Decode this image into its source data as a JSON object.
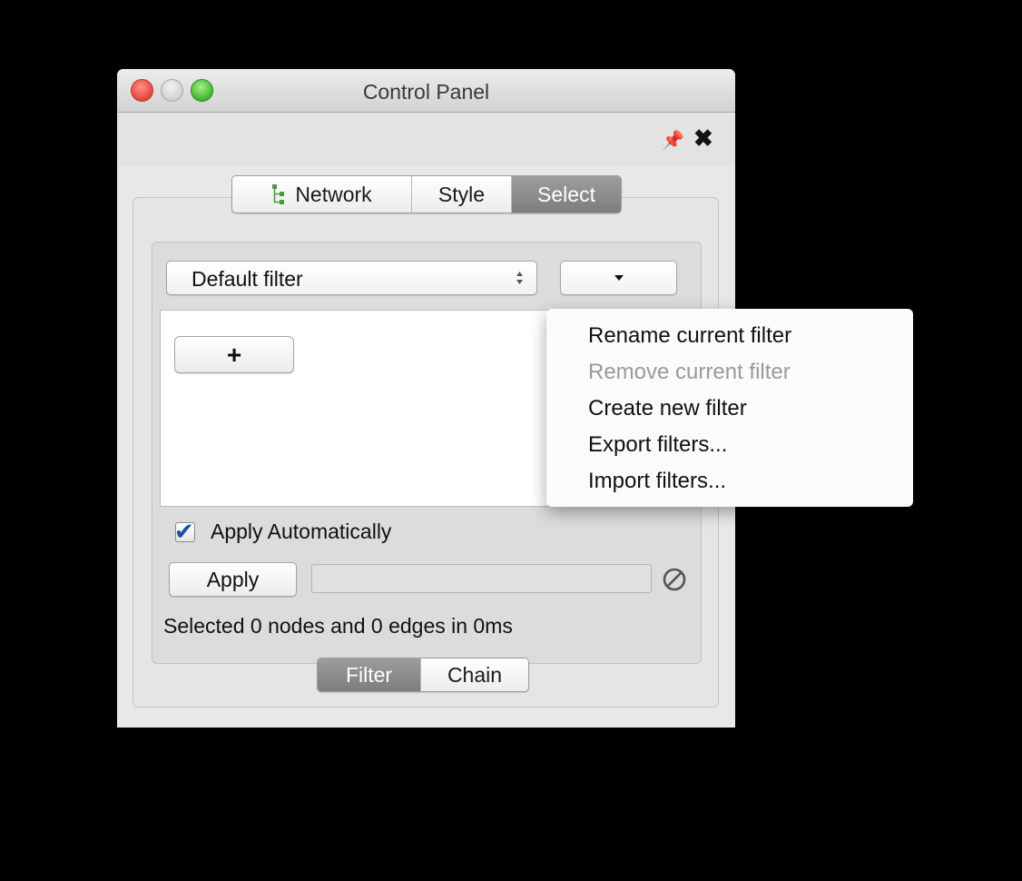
{
  "window": {
    "title": "Control Panel"
  },
  "header": {
    "pin_icon": "pin-icon",
    "close_icon": "close-icon"
  },
  "main_tabs": [
    {
      "label": "Network",
      "icon": "network-tree-icon",
      "active": false
    },
    {
      "label": "Style",
      "active": false
    },
    {
      "label": "Select",
      "active": true
    }
  ],
  "filter": {
    "selected": "Default filter",
    "menu_button_icon": "caret-down-icon",
    "add_label": "+"
  },
  "dropdown": {
    "items": [
      {
        "label": "Rename current filter",
        "enabled": true
      },
      {
        "label": "Remove current filter",
        "enabled": false
      },
      {
        "label": "Create new filter",
        "enabled": true
      },
      {
        "label": "Export filters...",
        "enabled": true
      },
      {
        "label": "Import filters...",
        "enabled": true
      }
    ]
  },
  "apply_automatically": {
    "label": "Apply Automatically",
    "checked": true
  },
  "apply_button": "Apply",
  "status": "Selected 0 nodes and 0 edges in 0ms",
  "bottom_tabs": [
    {
      "label": "Filter",
      "active": true
    },
    {
      "label": "Chain",
      "active": false
    }
  ],
  "colors": {
    "accent_check": "#17529e",
    "active_tab": "#8a8a8a"
  }
}
